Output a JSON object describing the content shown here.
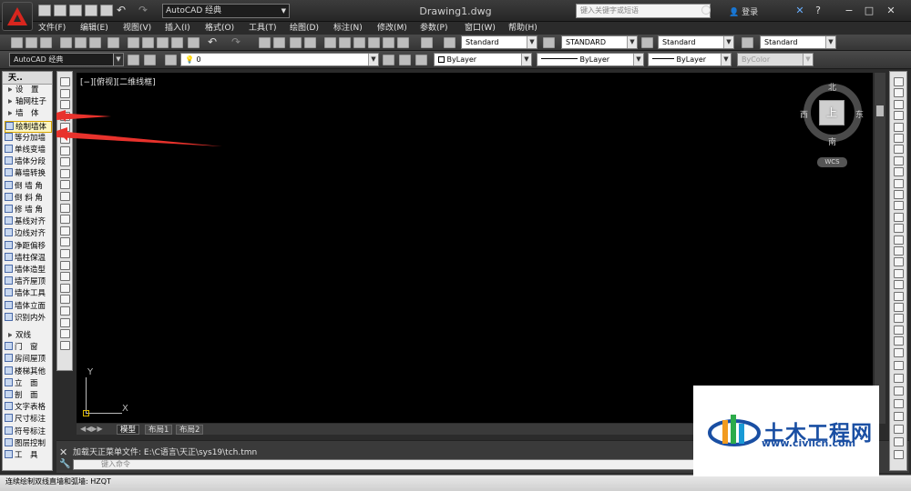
{
  "title_bar": {
    "workspace": "AutoCAD 经典",
    "doc_title": "Drawing1.dwg",
    "search_placeholder": "键入关键字或短语",
    "login": "登录"
  },
  "menu": [
    "文件(F)",
    "编辑(E)",
    "视图(V)",
    "插入(I)",
    "格式(O)",
    "工具(T)",
    "绘图(D)",
    "标注(N)",
    "修改(M)",
    "参数(P)",
    "窗口(W)",
    "帮助(H)"
  ],
  "toolbar": {
    "text_style": "Standard",
    "dim_style": "STANDARD",
    "table_style": "Standard",
    "multileader_style": "Standard",
    "workspace2": "AutoCAD 经典",
    "layer": "0",
    "color": "ByLayer",
    "linetype": "ByLayer",
    "lineweight": "ByLayer",
    "plotstyle": "ByColor"
  },
  "left_panel": {
    "header": "天..",
    "items": [
      "设　置",
      "轴网柱子",
      "墙　体",
      "绘制墙体",
      "等分加墙",
      "单线变墙",
      "墙体分段",
      "幕墙转换",
      "倒 墙 角",
      "倒 斜 角",
      "修 墙 角",
      "基线对齐",
      "边线对齐",
      "净距偏移",
      "墙柱保温",
      "墙体造型",
      "墙齐屋顶",
      "墙体工具",
      "墙体立面",
      "识别内外",
      "双线",
      "门　窗",
      "房间屋顶",
      "楼梯其他",
      "立　面",
      "剖　面",
      "文字表格",
      "尺寸标注",
      "符号标注",
      "图层控制",
      "工　具"
    ]
  },
  "viewport": {
    "label": "[−][俯视][二维线框]",
    "north": "北",
    "south": "南",
    "east": "东",
    "west": "西",
    "cube_face": "上",
    "wcs": "WCS",
    "ucs_y": "Y",
    "ucs_x": "X"
  },
  "tabs": [
    "模型",
    "布局1",
    "布局2"
  ],
  "command": {
    "history": "加载天正菜单文件: E:\\C语言\\天正\\sys19\\tch.tmn",
    "placeholder": "键入命令"
  },
  "status": {
    "text": "连续绘制双线直墙和弧墙: HZQT"
  },
  "watermark": {
    "title": "土木工程网",
    "url": "www.civilcn.com"
  },
  "colors": {
    "canvas": "#000000",
    "arrow": "#e8322c",
    "highlight": "#fdf7c3",
    "brand": "#1a4fa3"
  }
}
